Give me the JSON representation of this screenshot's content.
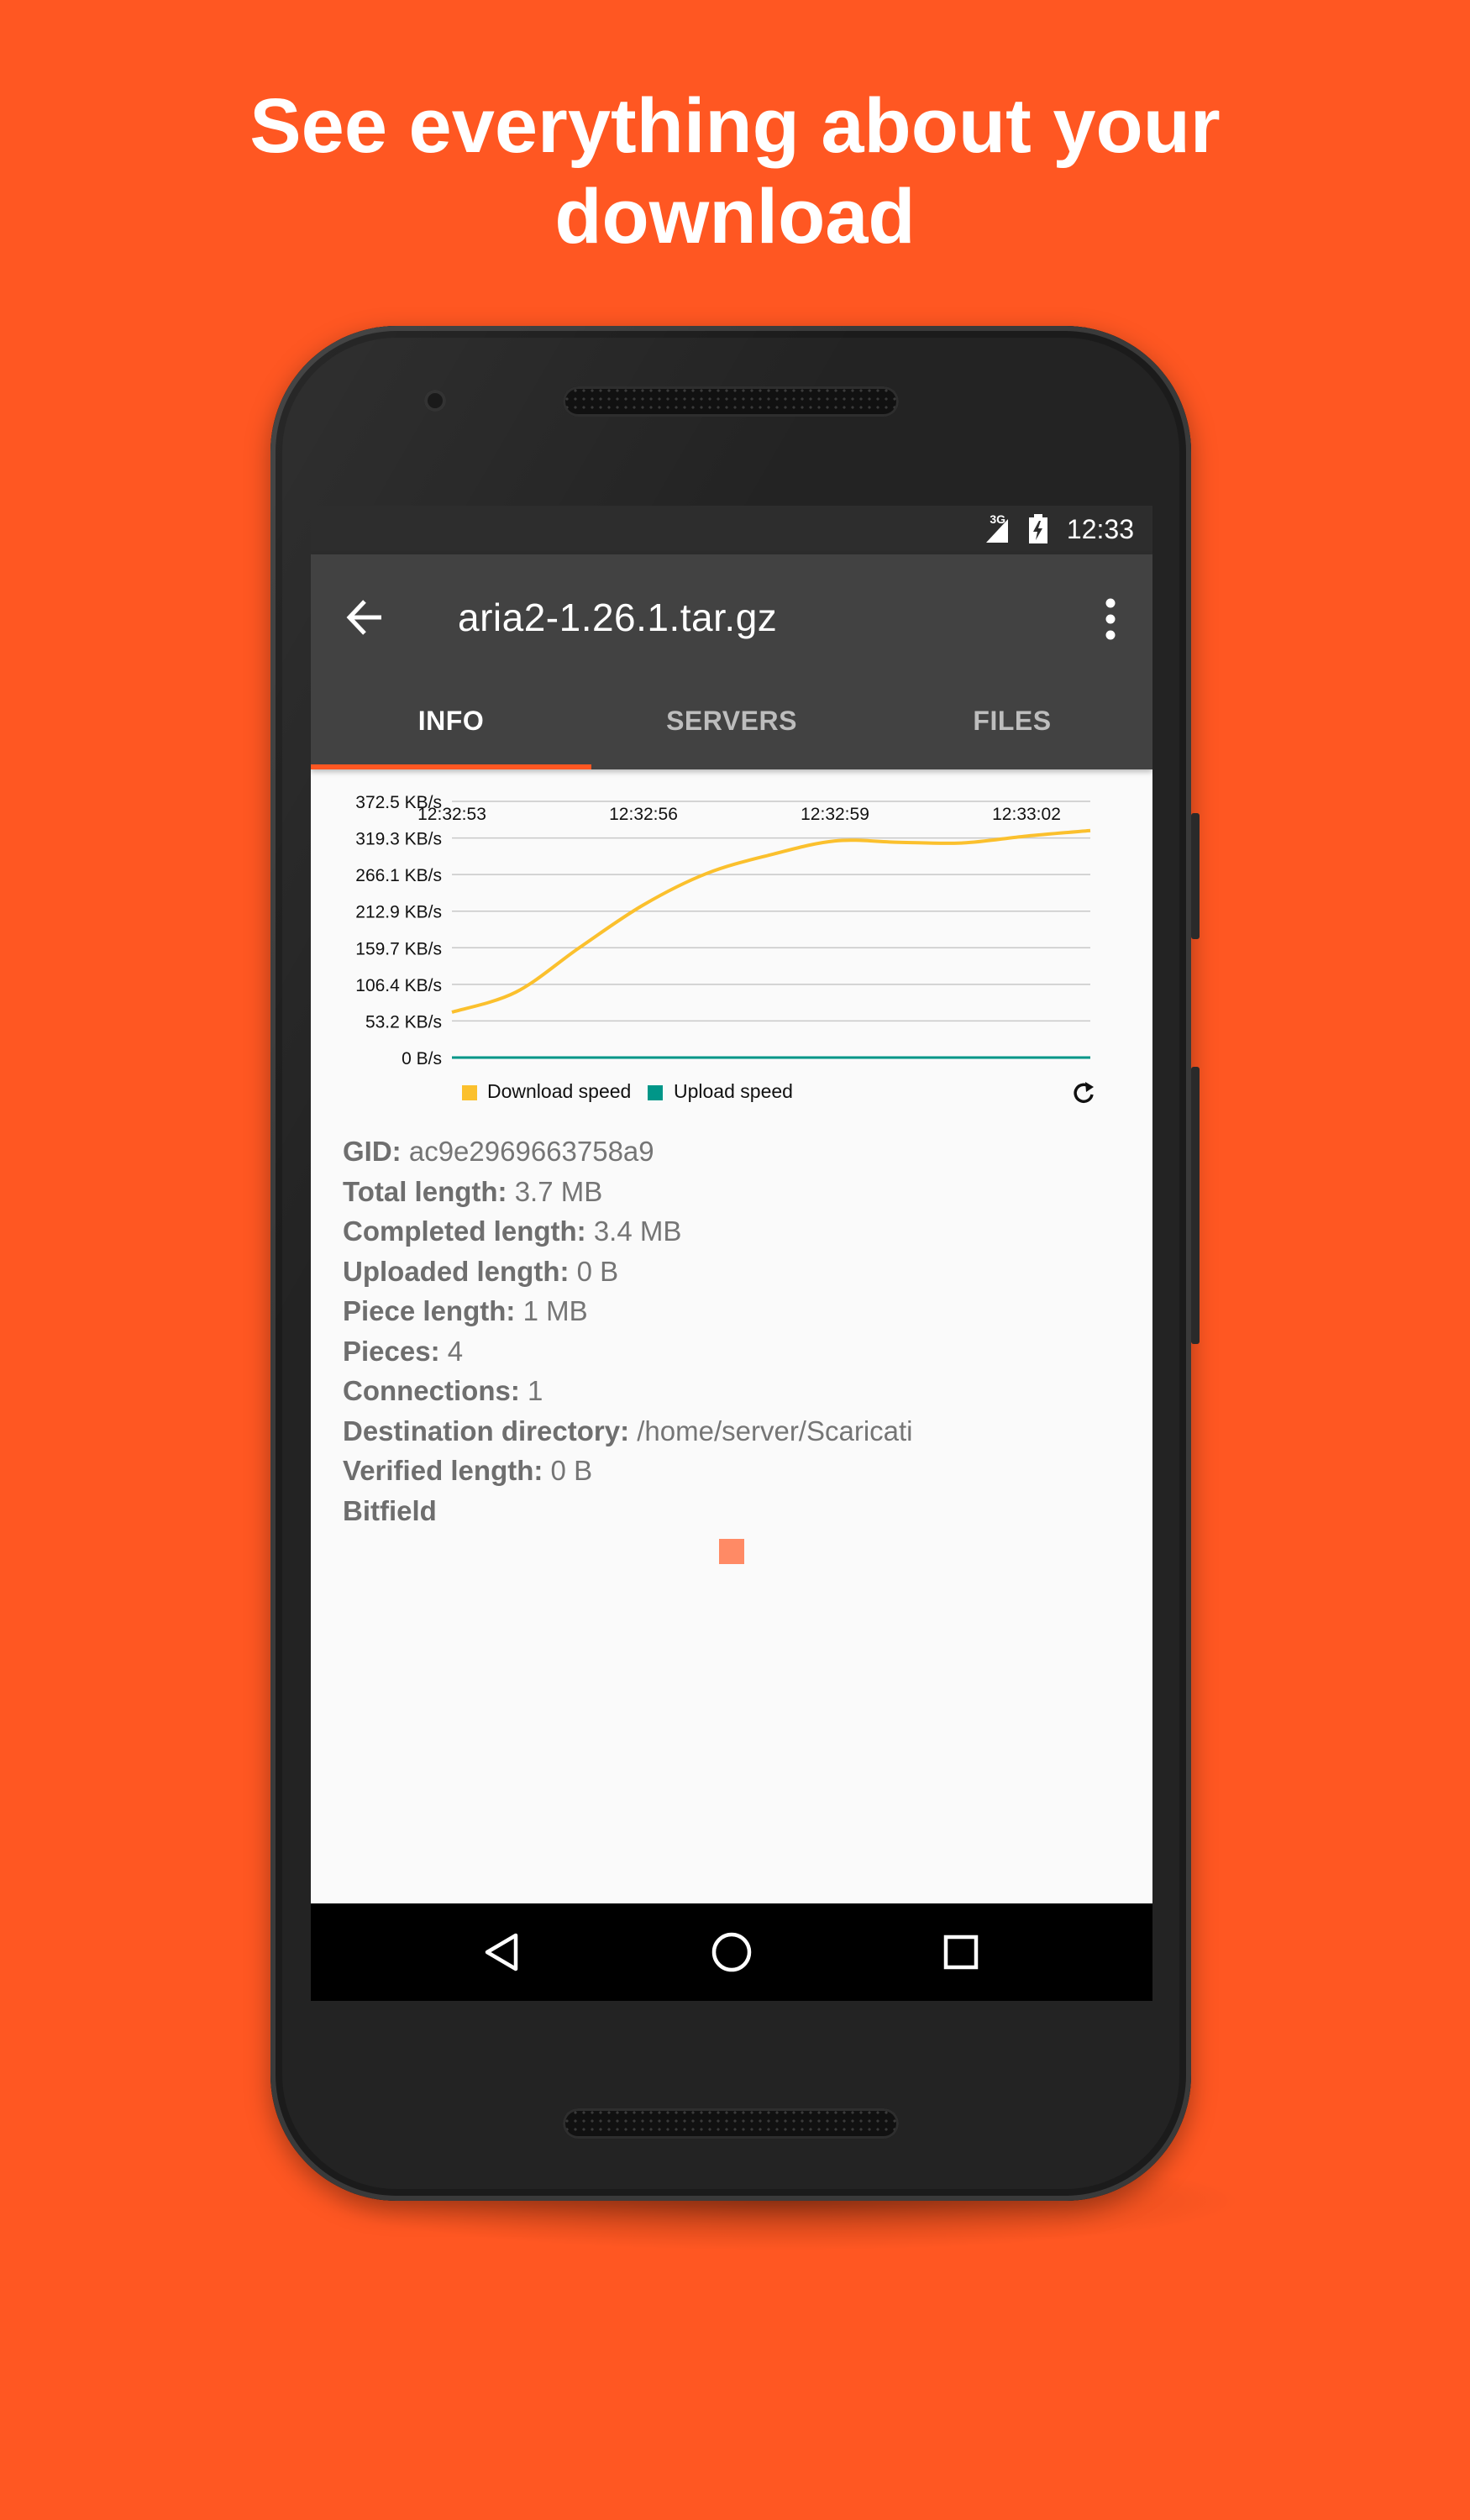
{
  "headline": {
    "line1": "See everything about your",
    "line2": "download"
  },
  "status_bar": {
    "network": "3G",
    "time": "12:33"
  },
  "app_bar": {
    "title": "aria2-1.26.1.tar.gz",
    "back_icon": "arrow-left-icon",
    "menu_icon": "more-vert-icon"
  },
  "tabs": [
    {
      "label": "INFO",
      "active": true
    },
    {
      "label": "SERVERS",
      "active": false
    },
    {
      "label": "FILES",
      "active": false
    }
  ],
  "chart_data": {
    "type": "line",
    "x": [
      "12:32:53",
      "12:32:54",
      "12:32:55",
      "12:32:56",
      "12:32:57",
      "12:32:58",
      "12:32:59",
      "12:33:00",
      "12:33:01",
      "12:33:02",
      "12:33:03"
    ],
    "x_tick_labels": [
      "12:32:53",
      "12:32:56",
      "12:32:59",
      "12:33:02"
    ],
    "y_tick_labels": [
      "372.5 KB/s",
      "319.3 KB/s",
      "266.1 KB/s",
      "212.9 KB/s",
      "159.7 KB/s",
      "106.4 KB/s",
      "53.2 KB/s",
      "0 B/s"
    ],
    "y_unit": "KB/s",
    "ylim": [
      0,
      372.5
    ],
    "series": [
      {
        "name": "Download speed",
        "color": "#FBC02D",
        "values": [
          66,
          95,
          160,
          222,
          268,
          295,
          315,
          313,
          312,
          322,
          330
        ]
      },
      {
        "name": "Upload speed",
        "color": "#009688",
        "values": [
          0,
          0,
          0,
          0,
          0,
          0,
          0,
          0,
          0,
          0,
          0
        ]
      }
    ],
    "grid": true,
    "legend": "bottom-left",
    "refresh_icon": "refresh-icon"
  },
  "info": [
    {
      "key": "GID:",
      "value": "ac9e2969663758a9"
    },
    {
      "key": "Total length:",
      "value": "3.7 MB"
    },
    {
      "key": "Completed length:",
      "value": "3.4 MB"
    },
    {
      "key": "Uploaded length:",
      "value": "0 B"
    },
    {
      "key": "Piece length:",
      "value": "1 MB"
    },
    {
      "key": "Pieces:",
      "value": "4"
    },
    {
      "key": "Connections:",
      "value": "1"
    },
    {
      "key": "Destination directory:",
      "value": "/home/server/Scaricati"
    },
    {
      "key": "Verified length:",
      "value": "0 B"
    },
    {
      "key": "Bitfield",
      "value": ""
    }
  ],
  "colors": {
    "accent": "#FF5722",
    "app_bar": "#424242",
    "bitfield_piece": "#FF8A65"
  },
  "nav_bar": {
    "back_icon": "nav-back-icon",
    "home_icon": "nav-home-icon",
    "recents_icon": "nav-recents-icon"
  }
}
